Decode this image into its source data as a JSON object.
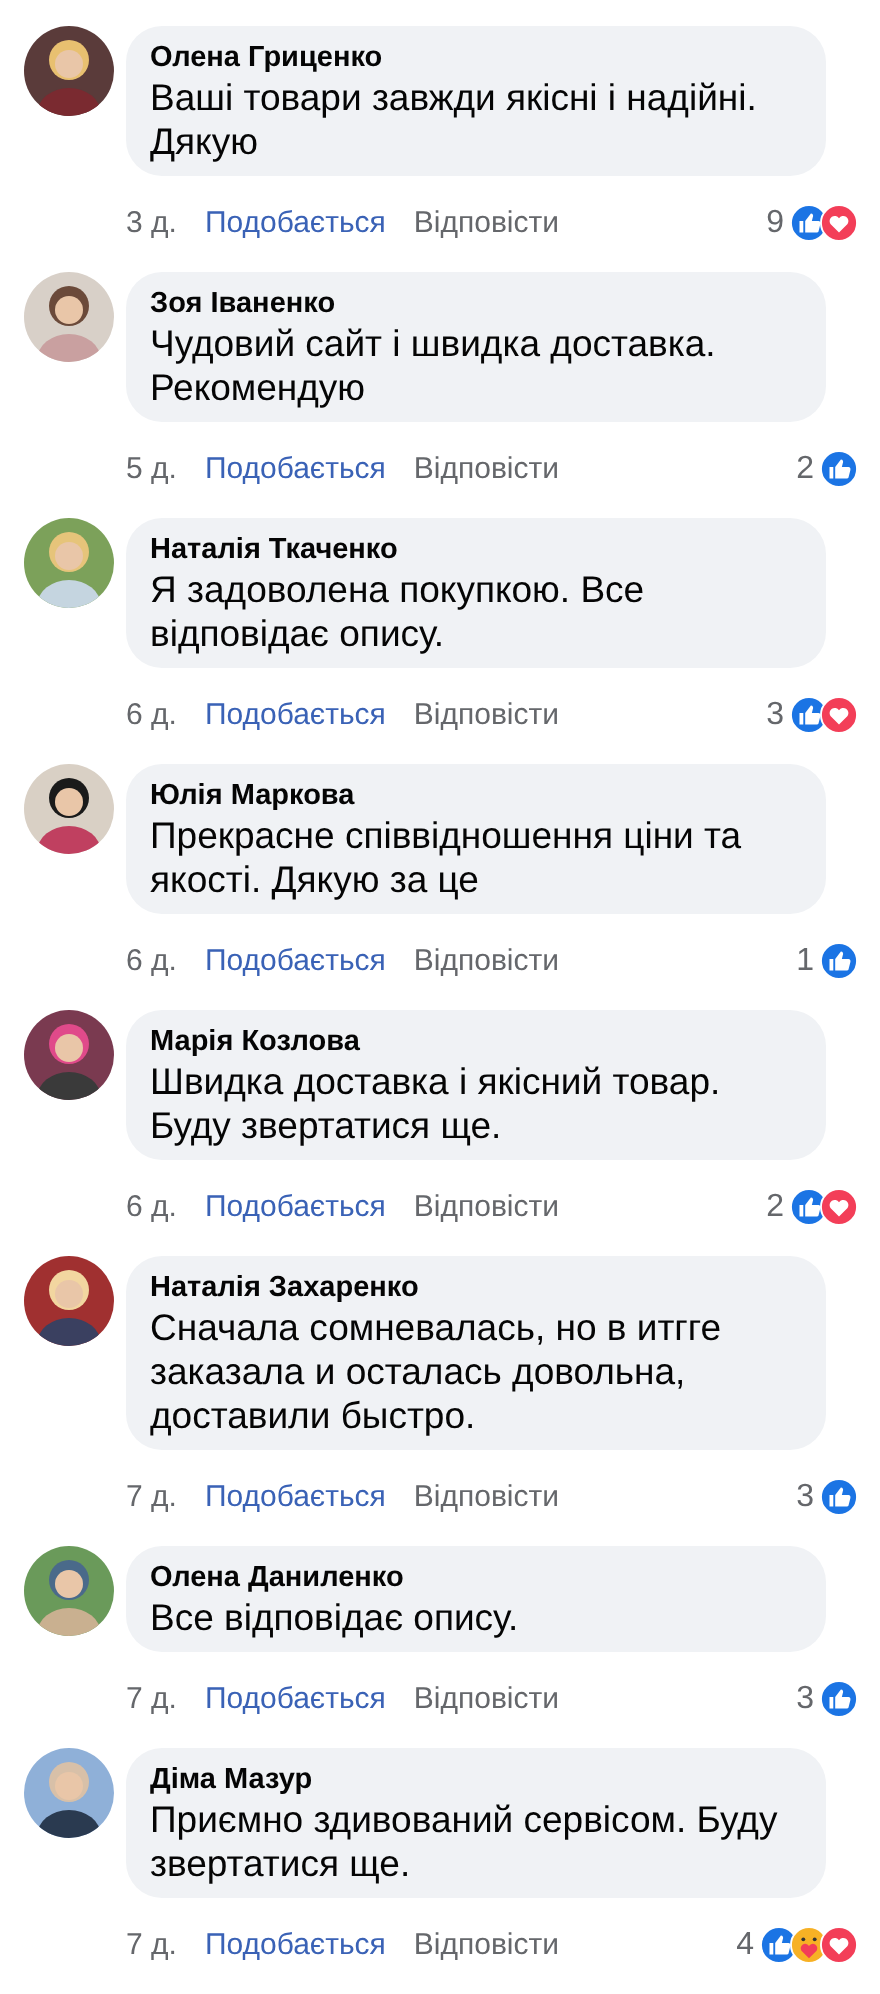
{
  "comments": [
    {
      "author": "Олена Гриценко",
      "text": "Ваші товари завжди якісні і надійні. Дякую",
      "time": "3 д.",
      "like": "Подобається",
      "reply": "Відповісти",
      "count": "9",
      "reactions": [
        {
          "kind": "like"
        },
        {
          "kind": "love"
        }
      ]
    },
    {
      "author": "Зоя Іваненко",
      "text": "Чудовий сайт і швидка доставка. Рекомендую",
      "time": "5 д.",
      "like": "Подобається",
      "reply": "Відповісти",
      "count": "2",
      "reactions": [
        {
          "kind": "like"
        }
      ]
    },
    {
      "author": "Наталія Ткаченко",
      "text": "Я задоволена покупкою. Все відповідає опису.",
      "time": "6 д.",
      "like": "Подобається",
      "reply": "Відповісти",
      "count": "3",
      "reactions": [
        {
          "kind": "like"
        },
        {
          "kind": "love"
        }
      ]
    },
    {
      "author": "Юлія Маркова",
      "text": "Прекрасне співвідношення ціни та якості. Дякую за це",
      "time": "6 д.",
      "like": "Подобається",
      "reply": "Відповісти",
      "count": "1",
      "reactions": [
        {
          "kind": "like"
        }
      ]
    },
    {
      "author": "Марія Козлова",
      "text": "Швидка доставка і якісний товар. Буду звертатися ще.",
      "time": "6 д.",
      "like": "Подобається",
      "reply": "Відповісти",
      "count": "2",
      "reactions": [
        {
          "kind": "like"
        },
        {
          "kind": "love"
        }
      ]
    },
    {
      "author": "Наталія Захаренко",
      "text": "Сначала сомневалась, но в итгге заказала и осталась довольна, доставили быстро.",
      "time": "7 д.",
      "like": "Подобається",
      "reply": "Відповісти",
      "count": "3",
      "reactions": [
        {
          "kind": "like"
        }
      ]
    },
    {
      "author": "Олена Даниленко",
      "text": "Все відповідає опису.",
      "time": "7 д.",
      "like": "Подобається",
      "reply": "Відповісти",
      "count": "3",
      "reactions": [
        {
          "kind": "like"
        }
      ]
    },
    {
      "author": "Діма Мазур",
      "text": "Приємно здивований сервісом. Буду звертатися ще.",
      "time": "7 д.",
      "like": "Подобається",
      "reply": "Відповісти",
      "count": "4",
      "reactions": [
        {
          "kind": "like"
        },
        {
          "kind": "care"
        },
        {
          "kind": "love"
        }
      ]
    }
  ]
}
